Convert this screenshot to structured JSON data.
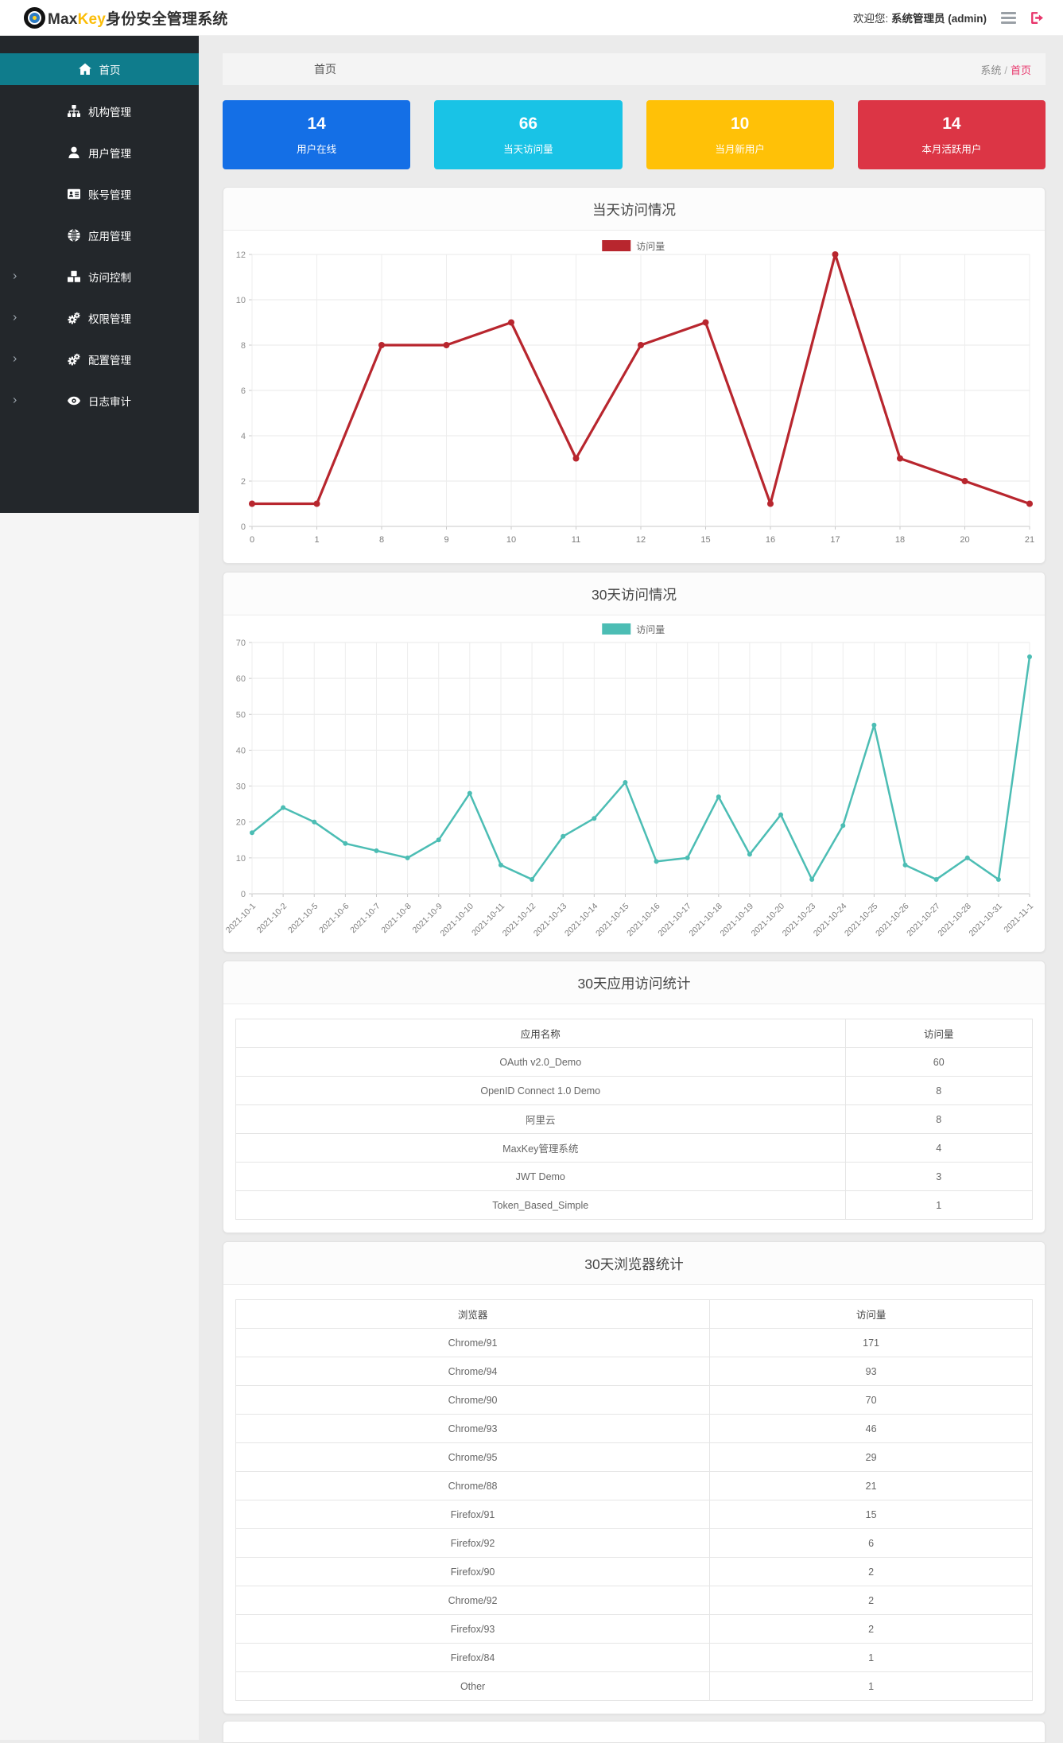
{
  "header": {
    "brand_max": "Max",
    "brand_key": "Key",
    "brand_suffix": "身份安全管理系统",
    "welcome_prefix": "欢迎您:",
    "user": "系统管理员 (admin)"
  },
  "breadcrumb": {
    "title": "首页",
    "root": "系统",
    "separator": "/",
    "current": "首页"
  },
  "sidebar": {
    "items": [
      {
        "key": "home",
        "label": "首页",
        "icon": "home-icon",
        "active": true,
        "expandable": false
      },
      {
        "key": "org",
        "label": "机构管理",
        "icon": "sitemap-icon",
        "active": false,
        "expandable": false
      },
      {
        "key": "user",
        "label": "用户管理",
        "icon": "user-icon",
        "active": false,
        "expandable": false
      },
      {
        "key": "account",
        "label": "账号管理",
        "icon": "id-card-icon",
        "active": false,
        "expandable": false
      },
      {
        "key": "app",
        "label": "应用管理",
        "icon": "globe-icon",
        "active": false,
        "expandable": false
      },
      {
        "key": "access",
        "label": "访问控制",
        "icon": "cubes-icon",
        "active": false,
        "expandable": true
      },
      {
        "key": "perm",
        "label": "权限管理",
        "icon": "gears-icon",
        "active": false,
        "expandable": true
      },
      {
        "key": "config",
        "label": "配置管理",
        "icon": "gears-icon",
        "active": false,
        "expandable": true
      },
      {
        "key": "audit",
        "label": "日志审计",
        "icon": "eye-icon",
        "active": false,
        "expandable": true
      }
    ]
  },
  "stats": [
    {
      "key": "online-users",
      "value": "14",
      "label": "用户在线",
      "color": "#146fe6"
    },
    {
      "key": "today-visits",
      "value": "66",
      "label": "当天访问量",
      "color": "#19c3e6"
    },
    {
      "key": "month-new-users",
      "value": "10",
      "label": "当月新用户",
      "color": "#ffc107"
    },
    {
      "key": "month-active-users",
      "value": "14",
      "label": "本月活跃用户",
      "color": "#dc3545"
    }
  ],
  "chart_data": [
    {
      "type": "line",
      "title": "当天访问情况",
      "legend": "访问量",
      "legend_position": "top-center",
      "color": "#b8262e",
      "grid": true,
      "categories": [
        "0",
        "1",
        "8",
        "9",
        "10",
        "11",
        "12",
        "15",
        "16",
        "17",
        "18",
        "20",
        "21"
      ],
      "values": [
        1,
        1,
        8,
        8,
        9,
        3,
        8,
        9,
        1,
        12,
        3,
        2,
        1
      ],
      "xlabel": "",
      "ylabel": "",
      "ylim": [
        0,
        12
      ],
      "yticks": [
        0,
        2,
        4,
        6,
        8,
        10,
        12
      ]
    },
    {
      "type": "line",
      "title": "30天访问情况",
      "legend": "访问量",
      "legend_position": "top-center",
      "color": "#4cbdb4",
      "grid": true,
      "categories": [
        "2021-10-1",
        "2021-10-2",
        "2021-10-5",
        "2021-10-6",
        "2021-10-7",
        "2021-10-8",
        "2021-10-9",
        "2021-10-10",
        "2021-10-11",
        "2021-10-12",
        "2021-10-13",
        "2021-10-14",
        "2021-10-15",
        "2021-10-16",
        "2021-10-17",
        "2021-10-18",
        "2021-10-19",
        "2021-10-20",
        "2021-10-23",
        "2021-10-24",
        "2021-10-25",
        "2021-10-26",
        "2021-10-27",
        "2021-10-28",
        "2021-10-31",
        "2021-11-1"
      ],
      "values": [
        17,
        24,
        20,
        14,
        12,
        10,
        15,
        28,
        8,
        4,
        16,
        21,
        31,
        9,
        10,
        27,
        11,
        22,
        4,
        19,
        47,
        8,
        4,
        10,
        4,
        66
      ],
      "xlabel": "",
      "ylabel": "",
      "ylim": [
        0,
        70
      ],
      "yticks": [
        0,
        10,
        20,
        30,
        40,
        50,
        60,
        70
      ]
    }
  ],
  "tables": [
    {
      "title": "30天应用访问统计",
      "col1_width": "76.5%",
      "headers": [
        "应用名称",
        "访问量"
      ],
      "rows": [
        [
          "OAuth v2.0_Demo",
          "60"
        ],
        [
          "OpenID Connect 1.0 Demo",
          "8"
        ],
        [
          "阿里云",
          "8"
        ],
        [
          "MaxKey管理系统",
          "4"
        ],
        [
          "JWT Demo",
          "3"
        ],
        [
          "Token_Based_Simple",
          "1"
        ]
      ]
    },
    {
      "title": "30天浏览器统计",
      "col1_width": "59.5%",
      "headers": [
        "浏览器",
        "访问量"
      ],
      "rows": [
        [
          "Chrome/91",
          "171"
        ],
        [
          "Chrome/94",
          "93"
        ],
        [
          "Chrome/90",
          "70"
        ],
        [
          "Chrome/93",
          "46"
        ],
        [
          "Chrome/95",
          "29"
        ],
        [
          "Chrome/88",
          "21"
        ],
        [
          "Firefox/91",
          "15"
        ],
        [
          "Firefox/92",
          "6"
        ],
        [
          "Firefox/90",
          "2"
        ],
        [
          "Chrome/92",
          "2"
        ],
        [
          "Firefox/93",
          "2"
        ],
        [
          "Firefox/84",
          "1"
        ],
        [
          "Other",
          "1"
        ]
      ]
    }
  ]
}
